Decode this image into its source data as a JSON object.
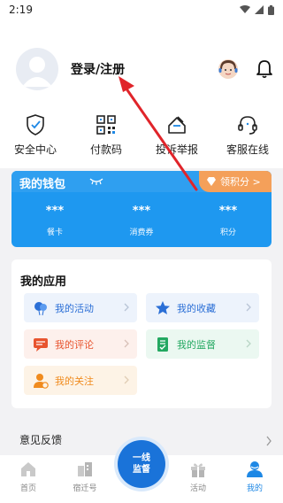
{
  "status_bar": {
    "time": "2:19"
  },
  "profile": {
    "login_label": "登录/注册"
  },
  "quick_actions": [
    {
      "label": "安全中心",
      "icon": "shield-check-icon"
    },
    {
      "label": "付款码",
      "icon": "qr-code-icon"
    },
    {
      "label": "投诉举报",
      "icon": "complaint-icon"
    },
    {
      "label": "客服在线",
      "icon": "headset-icon"
    }
  ],
  "wallet": {
    "title": "我的钱包",
    "points_tag": "领积分 >",
    "items": [
      {
        "value": "***",
        "label": "餐卡"
      },
      {
        "value": "***",
        "label": "消费券"
      },
      {
        "value": "***",
        "label": "积分"
      }
    ]
  },
  "apps": {
    "title": "我的应用",
    "items": [
      {
        "label": "我的活动",
        "icon": "balloon-icon",
        "color": "#2b6fd6",
        "bg": "#edf3fc"
      },
      {
        "label": "我的收藏",
        "icon": "star-icon",
        "color": "#2b6fd6",
        "bg": "#edf3fc"
      },
      {
        "label": "我的评论",
        "icon": "comment-icon",
        "color": "#e8542f",
        "bg": "#fdf0ec"
      },
      {
        "label": "我的监督",
        "icon": "document-check-icon",
        "color": "#23a861",
        "bg": "#ebf8f1"
      },
      {
        "label": "我的关注",
        "icon": "user-follow-icon",
        "color": "#f08b1e",
        "bg": "#fdf3e6"
      }
    ]
  },
  "feedback": {
    "label": "意见反馈"
  },
  "bottom_nav": {
    "items": [
      {
        "label": "首页",
        "icon": "home-icon",
        "active": false
      },
      {
        "label": "宿迁号",
        "icon": "city-icon",
        "active": false
      },
      {
        "label": "活动",
        "icon": "gift-icon",
        "active": false
      },
      {
        "label": "我的",
        "icon": "profile-icon",
        "active": true
      }
    ],
    "center_line1": "一线",
    "center_line2": "监督"
  },
  "colors": {
    "accent": "#1e88e5",
    "wallet_blue": "#1e98f0",
    "points_orange": "#f4a05a",
    "arrow_red": "#e0242a"
  }
}
